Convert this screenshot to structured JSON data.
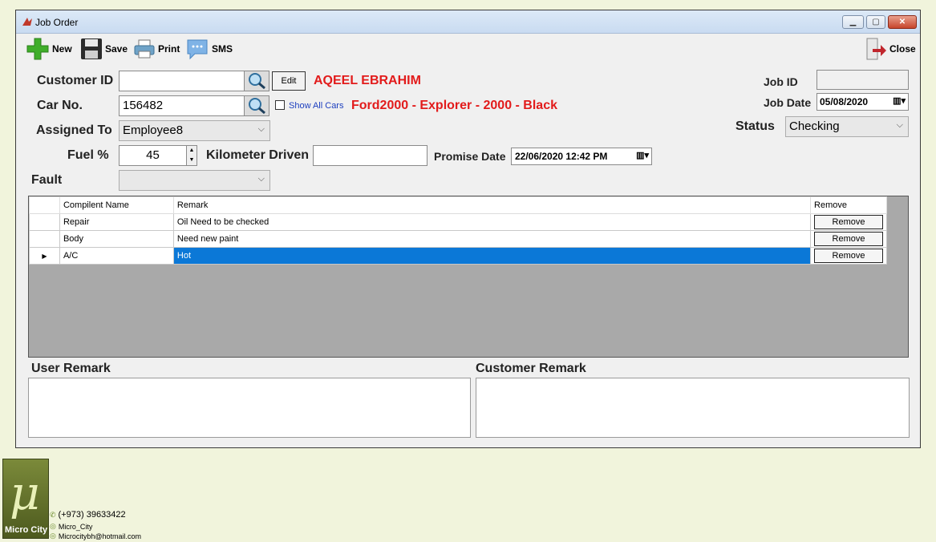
{
  "window": {
    "title": "Job Order"
  },
  "toolbar": {
    "new": "New",
    "save": "Save",
    "print": "Print",
    "sms": "SMS",
    "close": "Close"
  },
  "form": {
    "customer_id_label": "Customer ID",
    "customer_id_value": "",
    "edit_label": "Edit",
    "customer_name": "AQEEL EBRAHIM",
    "car_no_label": "Car No.",
    "car_no_value": "156482",
    "show_all_cars": "Show All Cars",
    "car_desc": "Ford2000 - Explorer - 2000 - Black",
    "assigned_to_label": "Assigned To",
    "assigned_to_value": "Employee8",
    "fuel_label": "Fuel %",
    "fuel_value": "45",
    "km_label": "Kilometer Driven",
    "km_value": "",
    "promise_date_label": "Promise Date",
    "promise_date_value": "22/06/2020 12:42 PM",
    "fault_label": "Fault",
    "fault_value": "",
    "job_id_label": "Job ID",
    "job_id_value": "",
    "job_date_label": "Job Date",
    "job_date_value": "05/08/2020",
    "status_label": "Status",
    "status_value": "Checking"
  },
  "grid": {
    "columns": [
      "Compilent Name",
      "Remark",
      "Remove"
    ],
    "rows": [
      {
        "name": "Repair",
        "remark": "Oil Need to be checked",
        "remove": "Remove"
      },
      {
        "name": "Body",
        "remark": "Need new paint",
        "remove": "Remove"
      },
      {
        "name": "A/C",
        "remark": "Hot",
        "remove": "Remove"
      }
    ]
  },
  "remarks": {
    "user_label": "User Remark",
    "customer_label": "Customer Remark"
  },
  "brand": {
    "logo_symbol": "μ",
    "name": "Micro City",
    "phone": "(+973) 39633422",
    "social": "Micro_City",
    "email": "Microcitybh@hotmail.com"
  },
  "colors": {
    "accent_red": "#e21b1b",
    "selection": "#0b78d7"
  }
}
